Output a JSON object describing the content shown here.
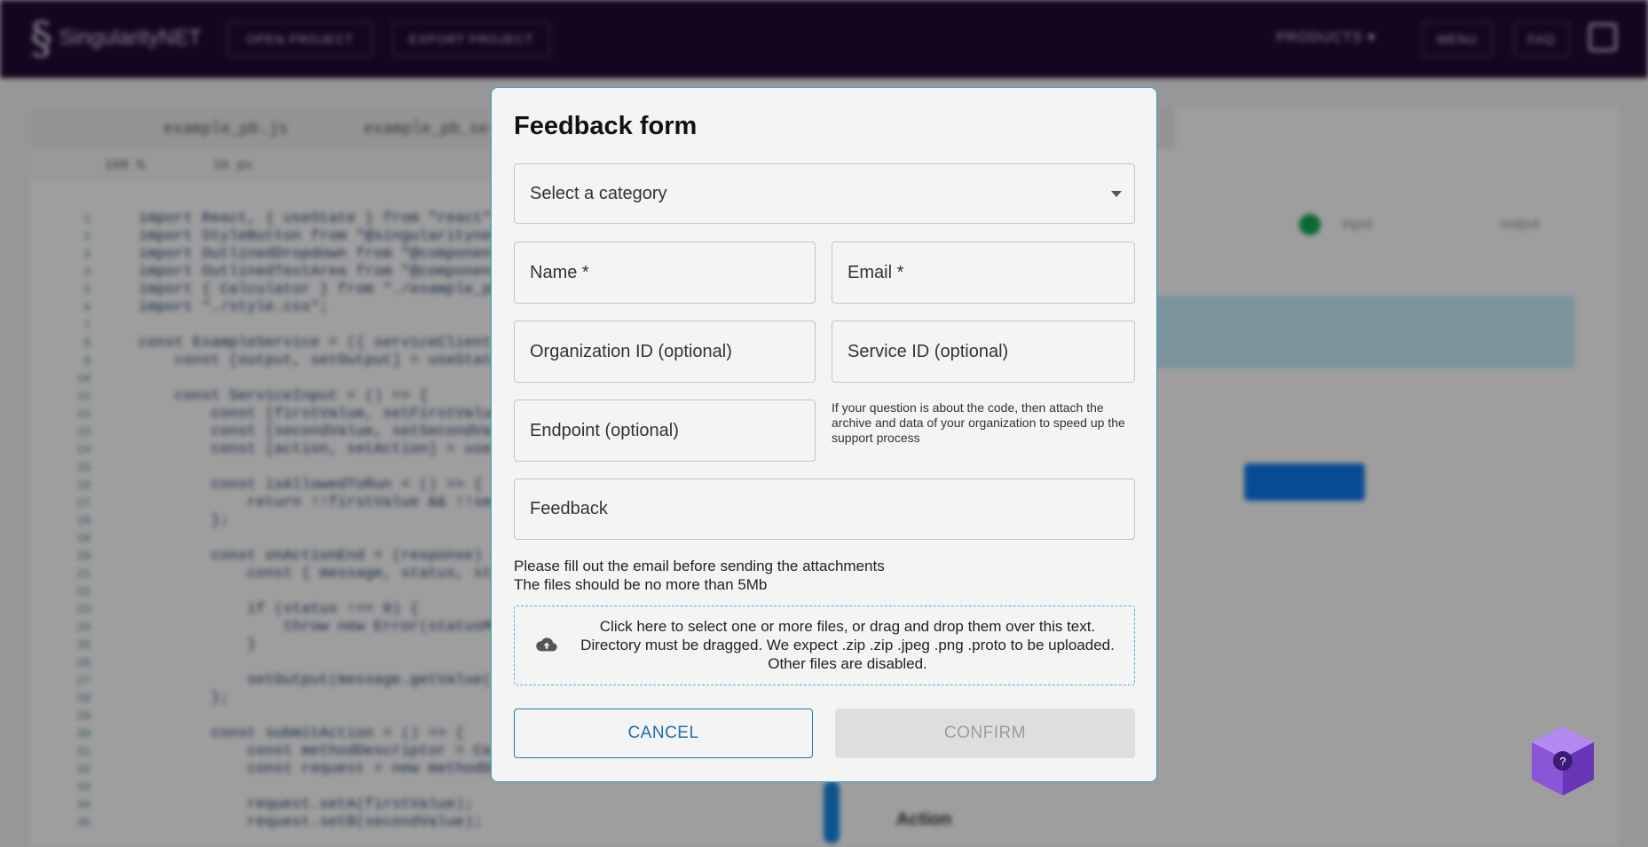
{
  "app": {
    "logo_text": "SingularityNET",
    "nav": {
      "open_project": "OPEN PROJECT",
      "export_project": "EXPORT PROJECT",
      "products": "PRODUCTS",
      "menu": "MENU",
      "faq": "FAQ"
    },
    "workspace": {
      "tabs": [
        "example_pb.js",
        "example_pb_se"
      ],
      "zoom": "100 %",
      "font_size": "16 px",
      "code_lines": [
        {
          "n": "1",
          "t": "import React, { useState } from \"react\";"
        },
        {
          "n": "2",
          "t": "import StyleButton from \"@singularitynet\";"
        },
        {
          "n": "3",
          "t": "import OutlinedDropdown from \"@component\";"
        },
        {
          "n": "4",
          "t": "import OutlinedTextArea from \"@component\";"
        },
        {
          "n": "5",
          "t": "import { Calculator } from \"./example_pb\";"
        },
        {
          "n": "6",
          "t": "import \"./style.css\";"
        },
        {
          "n": "7",
          "t": ""
        },
        {
          "n": "8",
          "t": "const ExampleService = ({ serviceClient"
        },
        {
          "n": "9",
          "t": "    const [output, setOutput] = useState"
        },
        {
          "n": "10",
          "t": ""
        },
        {
          "n": "11",
          "t": "    const ServiceInput = () => {"
        },
        {
          "n": "12",
          "t": "        const [firstValue, setFirstValue"
        },
        {
          "n": "13",
          "t": "        const [secondValue, setSecondVal"
        },
        {
          "n": "14",
          "t": "        const [action, setAction] = use"
        },
        {
          "n": "15",
          "t": ""
        },
        {
          "n": "16",
          "t": "        const isAllowedToRun = () => {"
        },
        {
          "n": "17",
          "t": "            return !!firstValue && !!sec"
        },
        {
          "n": "18",
          "t": "        };"
        },
        {
          "n": "19",
          "t": ""
        },
        {
          "n": "20",
          "t": "        const onActionEnd = (response) ="
        },
        {
          "n": "21",
          "t": "            const { message, status, sta"
        },
        {
          "n": "22",
          "t": ""
        },
        {
          "n": "23",
          "t": "            if (status !== 0) {"
        },
        {
          "n": "24",
          "t": "                throw new Error(statusMe"
        },
        {
          "n": "25",
          "t": "            }"
        },
        {
          "n": "26",
          "t": ""
        },
        {
          "n": "27",
          "t": "            setOutput(message.getValue("
        },
        {
          "n": "28",
          "t": "        };"
        },
        {
          "n": "29",
          "t": ""
        },
        {
          "n": "30",
          "t": "        const submitAction = () => {"
        },
        {
          "n": "31",
          "t": "            const methodDescriptor = Cal"
        },
        {
          "n": "32",
          "t": "            const request = new methodDe"
        },
        {
          "n": "33",
          "t": ""
        },
        {
          "n": "34",
          "t": "            request.setA(firstValue);"
        },
        {
          "n": "35",
          "t": "            request.setB(secondValue);"
        }
      ],
      "right": {
        "input_label": "input",
        "output_label": "output",
        "action_label": "Action",
        "colors": {
          "status": "#0fa04a",
          "button": "#0d74e0"
        }
      }
    }
  },
  "modal": {
    "title": "Feedback form",
    "category": {
      "placeholder": "Select a category",
      "icon": "chevron-down-icon"
    },
    "name": {
      "label": "Name *"
    },
    "email": {
      "label": "Email *"
    },
    "org_id": {
      "label": "Organization ID (optional)"
    },
    "service_id": {
      "label": "Service ID (optional)"
    },
    "endpoint": {
      "label": "Endpoint (optional)"
    },
    "hint": "If your question is about the code, then attach the archive and data of your organization to speed up the support process",
    "feedback": {
      "label": "Feedback"
    },
    "attach_note_1": "Please fill out the email before sending the attachments",
    "attach_note_2": "The files should be no more than 5Mb",
    "dropzone": {
      "icon": "cloud-upload-icon",
      "text": "Click here to select one or more files, or drag and drop them over this text. Directory must be dragged. We expect .zip .zip .jpeg .png .proto to be uploaded. Other files are disabled."
    },
    "buttons": {
      "cancel": "CANCEL",
      "confirm": "CONFIRM"
    },
    "colors": {
      "accent": "#1f78b4",
      "border": "#3d9fc6",
      "disabled": "#dedede"
    }
  },
  "help_widget": {
    "icon": "help-cube-icon",
    "glyph": "?"
  }
}
